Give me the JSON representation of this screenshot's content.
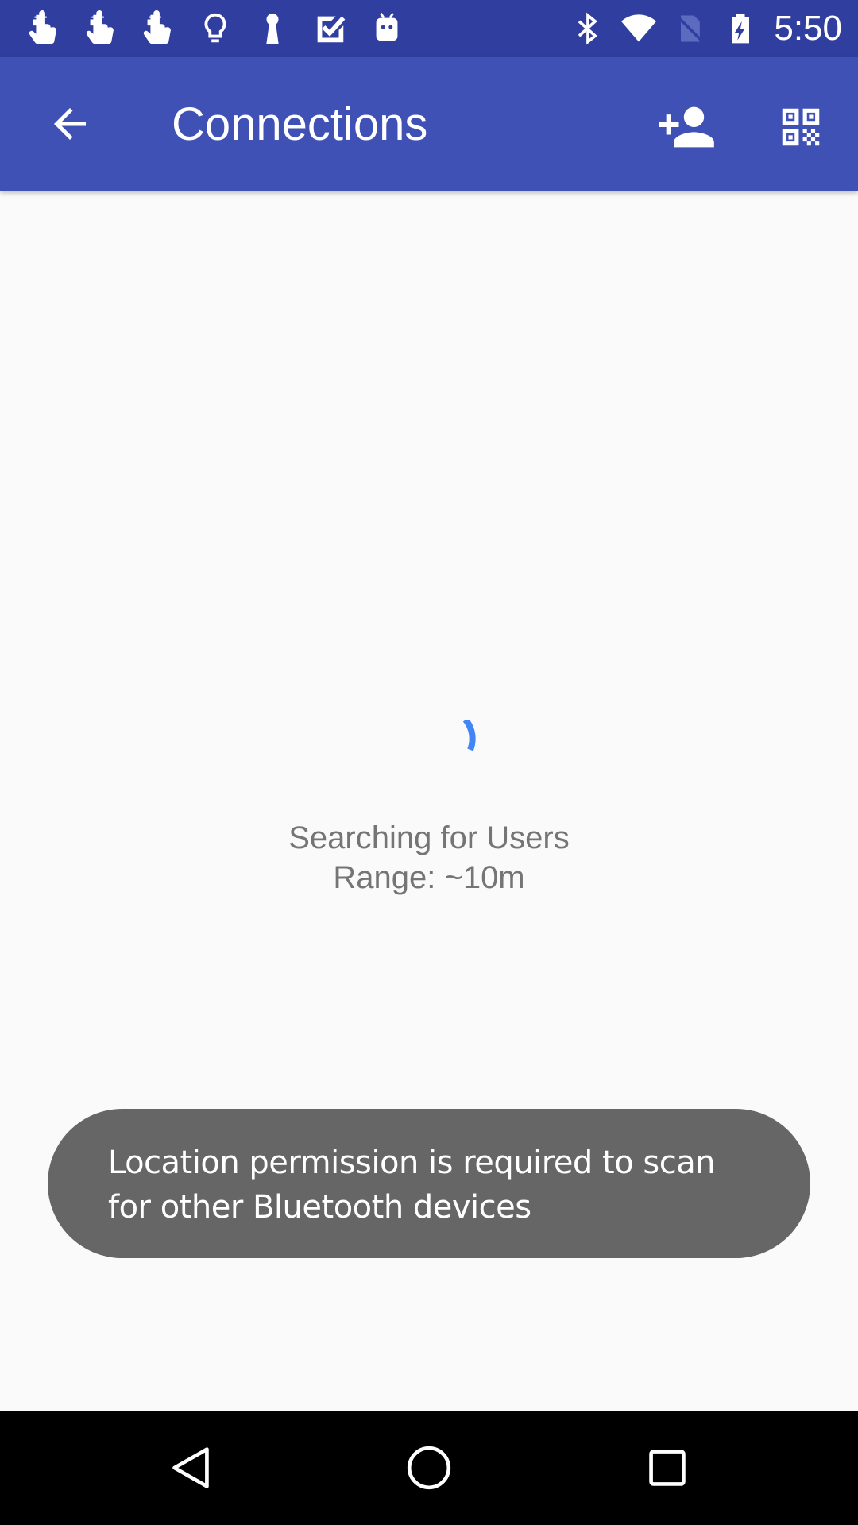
{
  "status_bar": {
    "time": "5:50",
    "notification_icons": [
      "touch-hand-icon",
      "touch-hand-icon",
      "touch-hand-icon",
      "lightbulb-icon",
      "keyhole-icon",
      "checkbox-icon",
      "android-icon"
    ],
    "system_icons": [
      "bluetooth-icon",
      "wifi-icon",
      "no-sim-icon",
      "battery-charging-icon"
    ]
  },
  "app_bar": {
    "title": "Connections",
    "actions": [
      "add-user-icon",
      "qr-code-icon"
    ]
  },
  "main": {
    "status_line1": "Searching for Users",
    "status_line2": "Range: ~10m"
  },
  "toast": {
    "line1": "Location permission is required to scan",
    "line2": "for other Bluetooth devices"
  },
  "nav_bar": {
    "buttons": [
      "back-triangle-icon",
      "home-circle-icon",
      "recents-square-icon"
    ]
  },
  "colors": {
    "status_bar": "#303f9f",
    "app_bar": "#3f51b5",
    "spinner": "#4285f4",
    "toast_bg": "#666666",
    "body_text": "#757575"
  }
}
